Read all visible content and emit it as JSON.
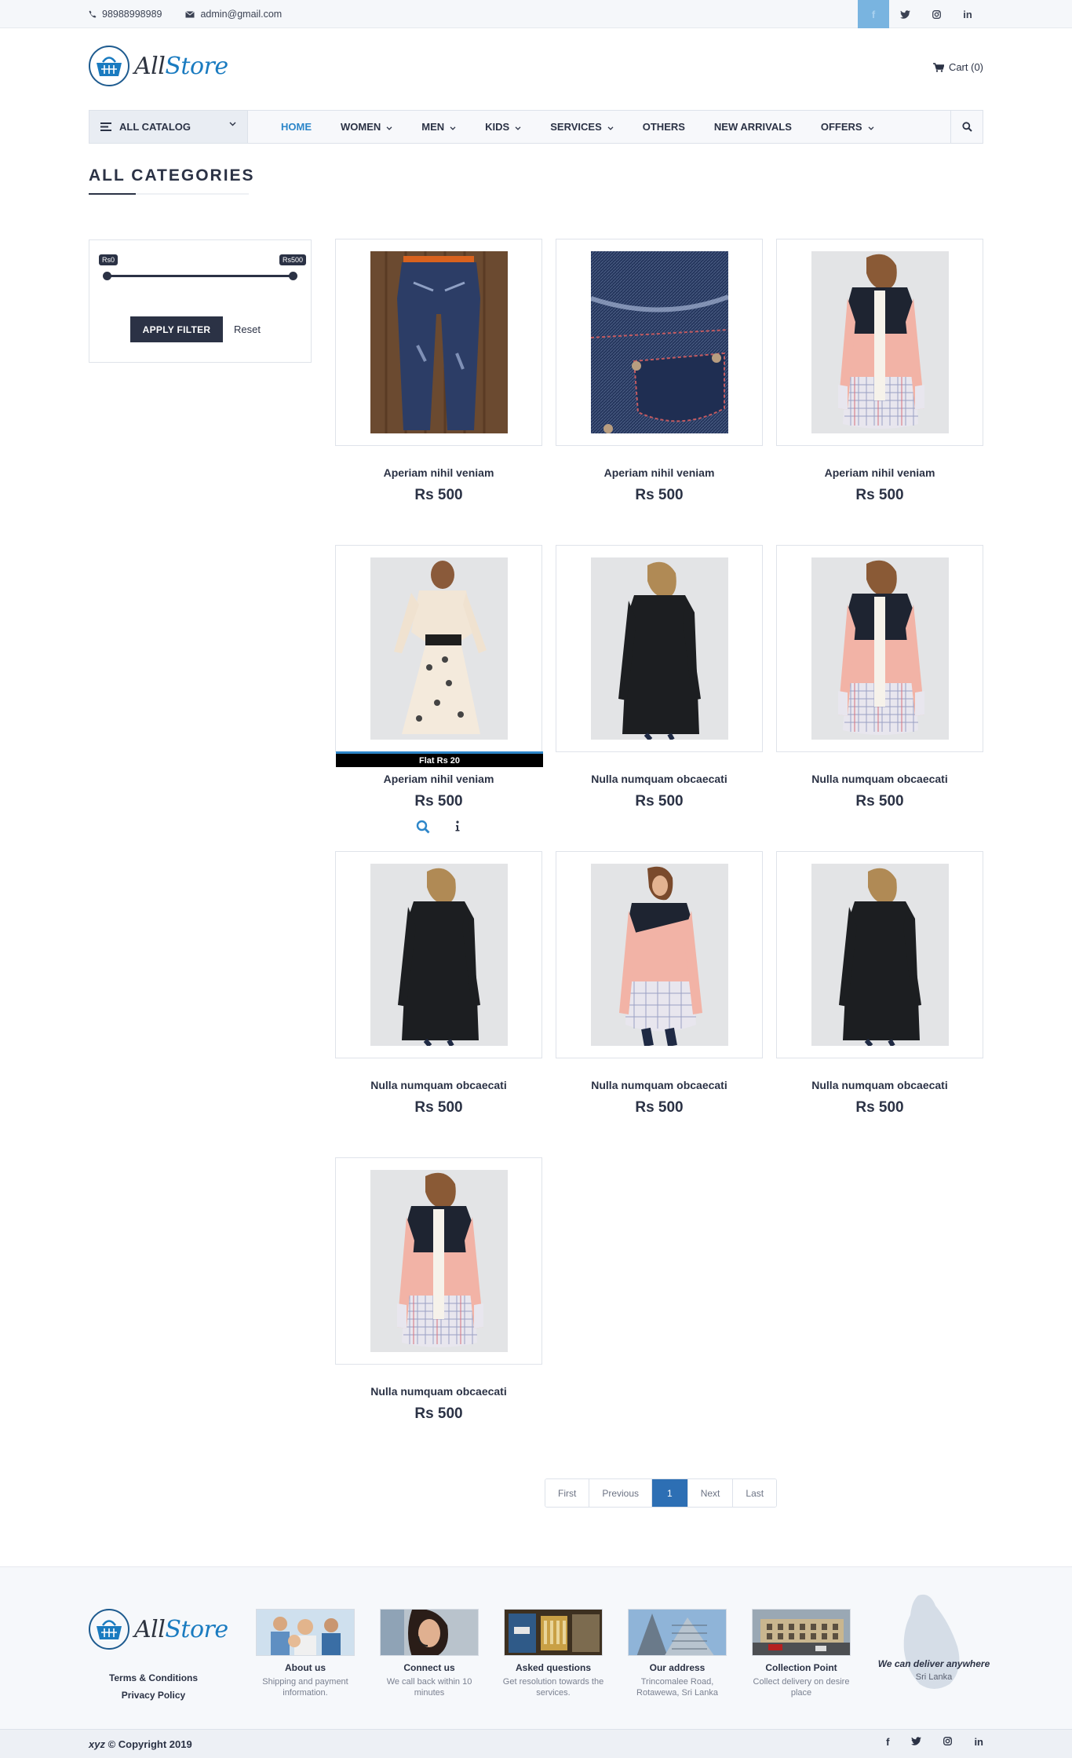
{
  "topbar": {
    "phone": "98988998989",
    "email": "admin@gmail.com",
    "social": [
      "f",
      "twitter",
      "instagram",
      "in"
    ]
  },
  "header": {
    "logo_part1": "All",
    "logo_part2": "Store",
    "cart_label": "Cart (0)"
  },
  "nav": {
    "catalog_label": "ALL CATALOG",
    "items": [
      {
        "label": "HOME",
        "dropdown": false,
        "active": true
      },
      {
        "label": "WOMEN",
        "dropdown": true
      },
      {
        "label": "MEN",
        "dropdown": true
      },
      {
        "label": "KIDS",
        "dropdown": true
      },
      {
        "label": "SERVICES",
        "dropdown": true
      },
      {
        "label": "OTHERS",
        "dropdown": false
      },
      {
        "label": "NEW ARRIVALS",
        "dropdown": false
      },
      {
        "label": "OFFERS",
        "dropdown": true
      }
    ]
  },
  "page": {
    "title": "ALL CATEGORIES"
  },
  "filter": {
    "min_label": "Rs0",
    "max_label": "Rs500",
    "apply_label": "APPLY FILTER",
    "reset_label": "Reset"
  },
  "products": [
    {
      "name": "Aperiam nihil veniam",
      "price": "Rs 500",
      "image": "jeans"
    },
    {
      "name": "Aperiam nihil veniam",
      "price": "Rs 500",
      "image": "denim-pocket"
    },
    {
      "name": "Aperiam nihil veniam",
      "price": "Rs 500",
      "image": "pink-top-back"
    },
    {
      "name": "Aperiam nihil veniam",
      "price": "Rs 500",
      "image": "cream-dress",
      "badge": "Flat Rs 20"
    },
    {
      "name": "Nulla numquam obcaecati",
      "price": "Rs 500",
      "image": "black-top"
    },
    {
      "name": "Nulla numquam obcaecati",
      "price": "Rs 500",
      "image": "pink-top-back"
    },
    {
      "name": "Nulla numquam obcaecati",
      "price": "Rs 500",
      "image": "black-top"
    },
    {
      "name": "Nulla numquam obcaecati",
      "price": "Rs 500",
      "image": "pink-top-front"
    },
    {
      "name": "Nulla numquam obcaecati",
      "price": "Rs 500",
      "image": "black-top"
    },
    {
      "name": "Nulla numquam obcaecati",
      "price": "Rs 500",
      "image": "pink-top-back"
    }
  ],
  "pagination": {
    "first": "First",
    "previous": "Previous",
    "current": "1",
    "next": "Next",
    "last": "Last"
  },
  "footer": {
    "links": [
      "Terms & Conditions",
      "Privacy Policy"
    ],
    "items": [
      {
        "title": "About us",
        "sub": "Shipping and payment information.",
        "thumb": "people"
      },
      {
        "title": "Connect us",
        "sub": "We call back within 10 minutes",
        "thumb": "callcenter"
      },
      {
        "title": "Asked questions",
        "sub": "Get resolution towards the services.",
        "thumb": "shop"
      },
      {
        "title": "Our address",
        "sub": "Trincomalee Road, Rotawewa, Sri Lanka",
        "thumb": "building"
      },
      {
        "title": "Collection Point",
        "sub": "Collect delivery on desire place",
        "thumb": "street"
      }
    ],
    "deliver_title": "We can deliver anywhere",
    "deliver_sub": "Sri Lanka",
    "copyright_brand": "xyz",
    "copyright_text": "© Copyright 2019",
    "social": [
      "f",
      "twitter",
      "instagram",
      "in"
    ]
  },
  "colors": {
    "primary": "#2b3245",
    "accent": "#2d86c9",
    "page_active": "#2d6fb4"
  }
}
